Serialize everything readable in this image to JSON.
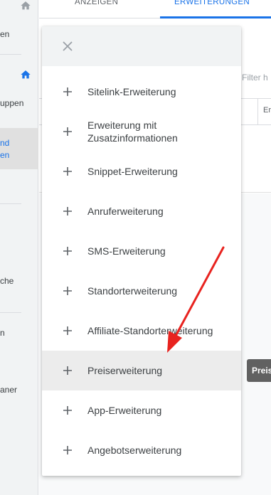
{
  "sidebar": {
    "items": [
      {
        "label": "en"
      },
      {
        "label": "uppen"
      },
      {
        "label": "nd"
      },
      {
        "label": "en"
      },
      {
        "label": "che"
      },
      {
        "label": "n"
      },
      {
        "label": "aner"
      }
    ]
  },
  "tabs": {
    "ads": "ANZEIGEN",
    "extensions": "ERWEITERUNGEN"
  },
  "table": {
    "filter_hint": "Filter h",
    "column_partial": "Er"
  },
  "tooltip": {
    "text": "Preis"
  },
  "menu": {
    "items": [
      {
        "label": "Sitelink-Erweiterung"
      },
      {
        "label": "Erweiterung mit Zusatzinformationen"
      },
      {
        "label": "Snippet-Erweiterung"
      },
      {
        "label": "Anruferweiterung"
      },
      {
        "label": "SMS-Erweiterung"
      },
      {
        "label": "Standorterweiterung"
      },
      {
        "label": "Affiliate-Standorterweiterung"
      },
      {
        "label": "Preiserweiterung"
      },
      {
        "label": "App-Erweiterung"
      },
      {
        "label": "Angebotserweiterung"
      }
    ],
    "highlighted_item": "Preiserweiterung"
  },
  "colors": {
    "accent": "#1a73e8",
    "annotation_arrow": "#e8231f",
    "hover_row": "#ececec"
  },
  "icons": {
    "close": "close-icon",
    "add": "plus-icon",
    "home": "home-icon"
  }
}
